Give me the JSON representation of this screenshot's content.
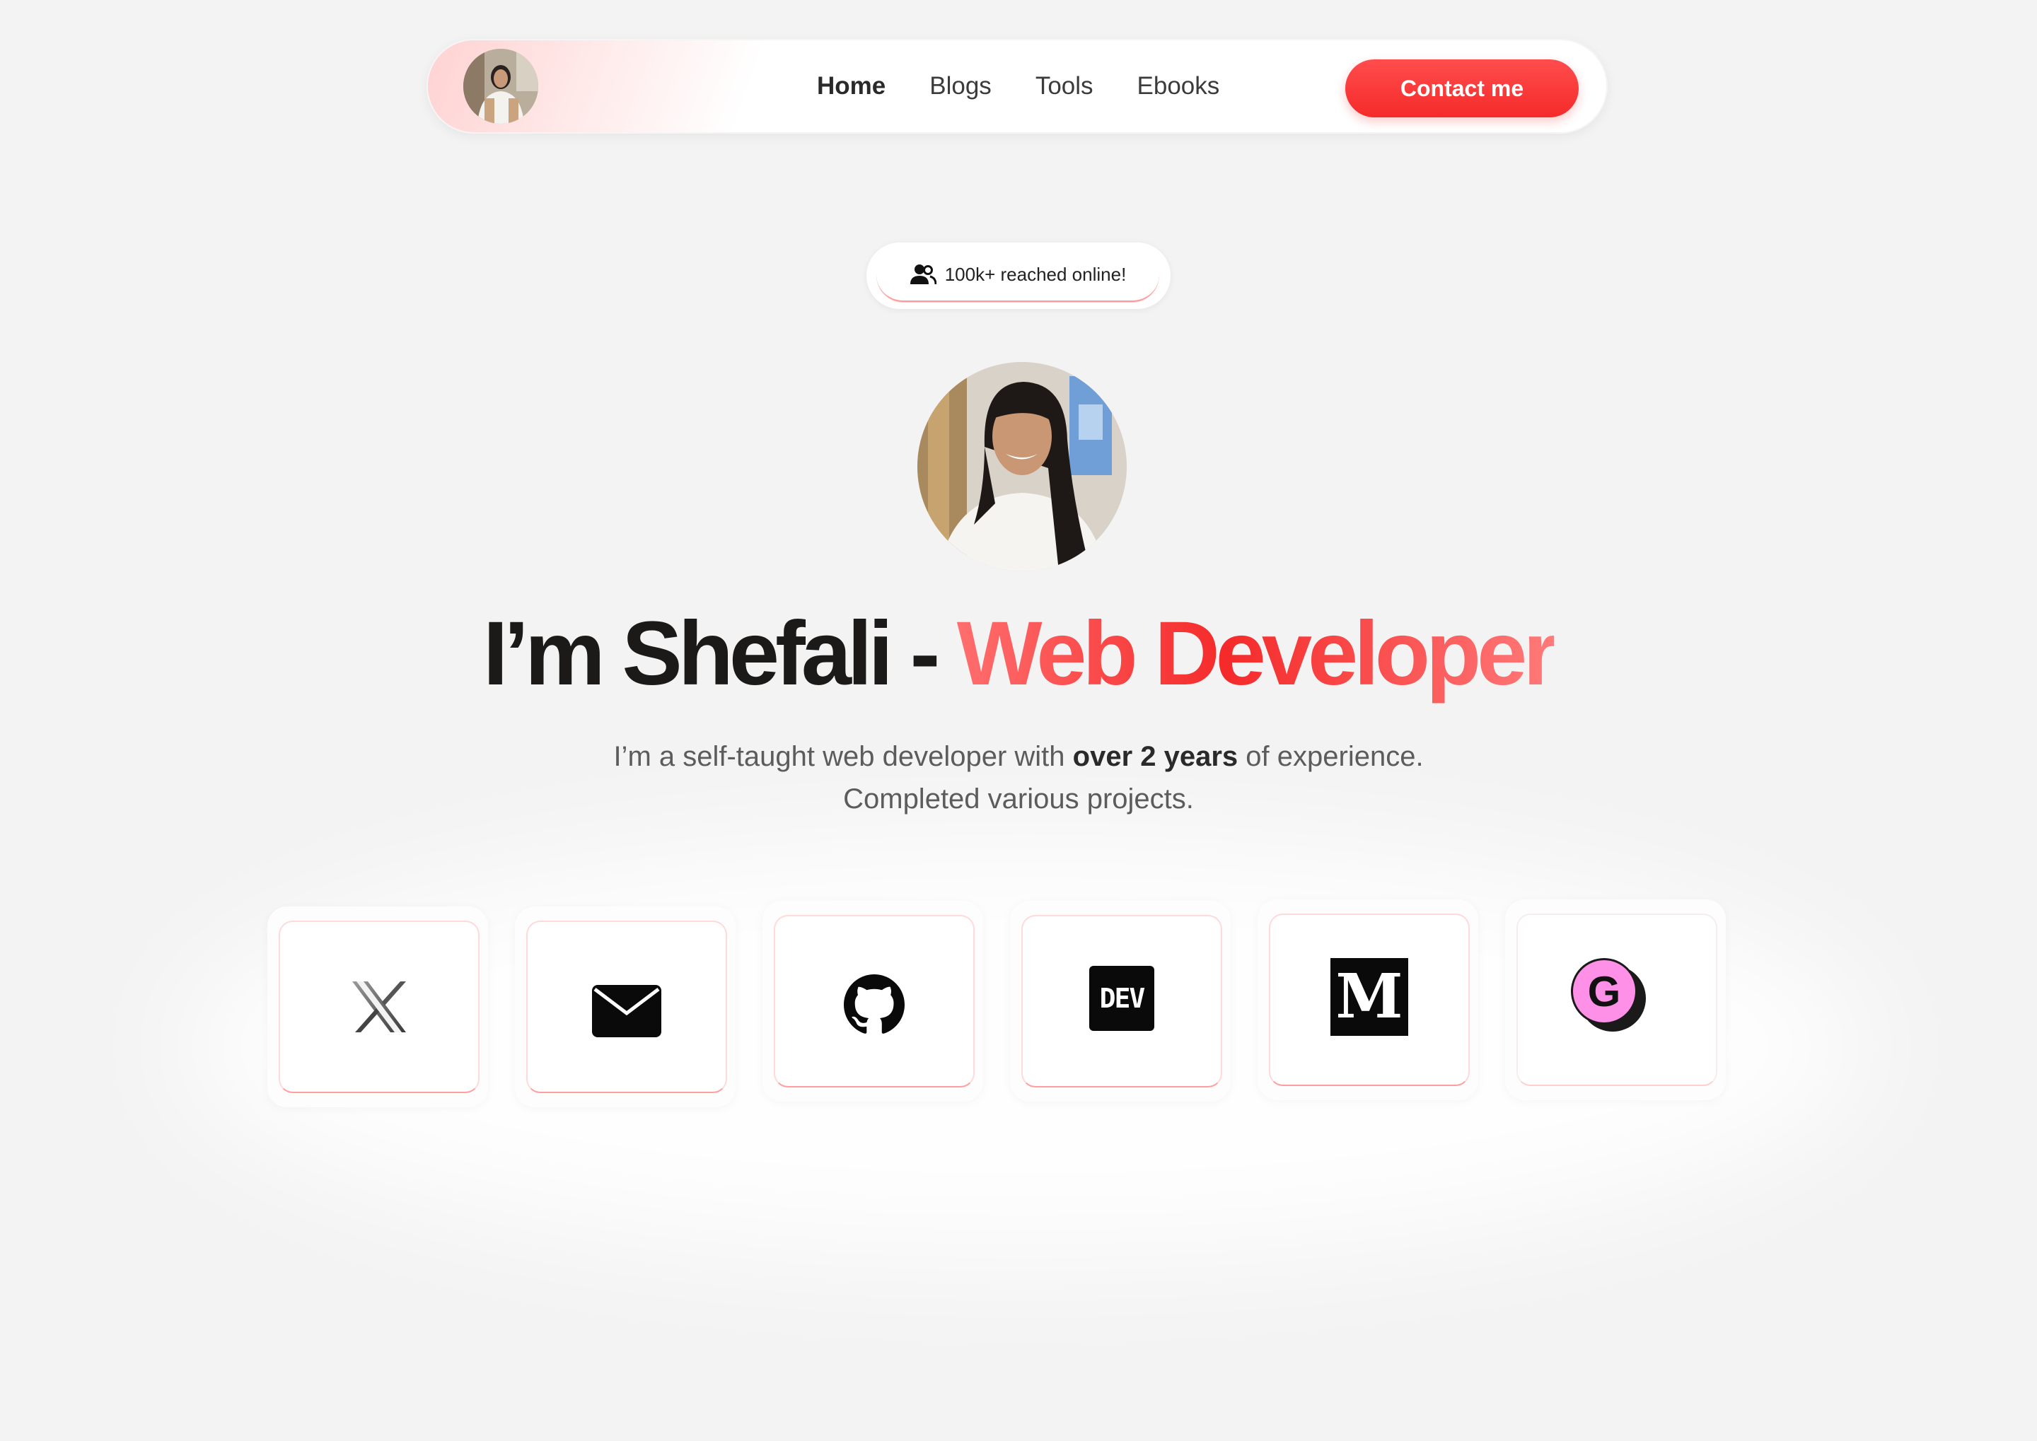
{
  "nav": {
    "links": [
      {
        "label": "Home",
        "active": true
      },
      {
        "label": "Blogs",
        "active": false
      },
      {
        "label": "Tools",
        "active": false
      },
      {
        "label": "Ebooks",
        "active": false
      }
    ],
    "contact_label": "Contact me"
  },
  "badge": {
    "icon": "users-icon",
    "text": "100k+ reached online!"
  },
  "hero": {
    "title_name": "I’m Shefali - ",
    "title_role": "Web Developer",
    "subtitle_pre": "I’m a self-taught web developer with ",
    "subtitle_bold": "over 2 years",
    "subtitle_post": " of experience.",
    "subtitle_line2": "Completed various projects."
  },
  "social_links": [
    {
      "name": "x-icon"
    },
    {
      "name": "mail-icon"
    },
    {
      "name": "github-icon"
    },
    {
      "name": "dev-icon",
      "label": "DEV"
    },
    {
      "name": "medium-icon",
      "label": "M"
    },
    {
      "name": "gumroad-icon",
      "label": "G"
    }
  ],
  "colors": {
    "accent": "#f52a2a",
    "background": "#f3f3f3"
  }
}
